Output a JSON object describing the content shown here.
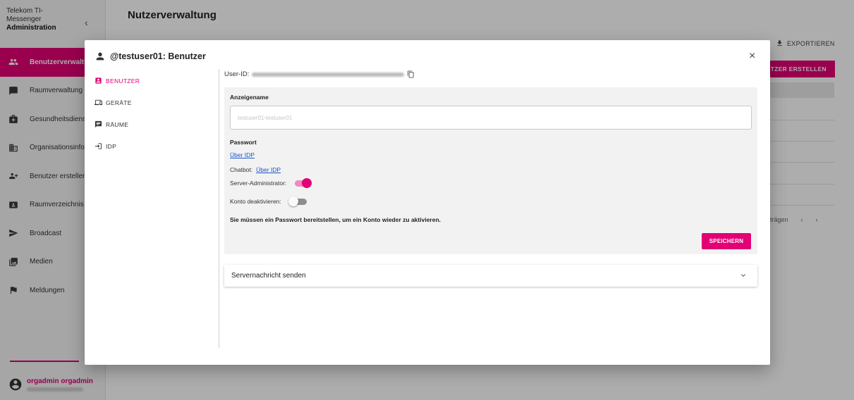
{
  "app": {
    "brand_line1": "Telekom TI-",
    "brand_line2": "Messenger",
    "brand_line3": "Administration",
    "collapse_icon": "‹"
  },
  "sidebar": {
    "items": [
      {
        "label": "Benutzerverwaltung",
        "icon": "people-icon"
      },
      {
        "label": "Raumverwaltung",
        "icon": "chat-icon"
      },
      {
        "label": "Gesundheitsdienste",
        "icon": "medical-bag-icon"
      },
      {
        "label": "Organisationsinfo",
        "icon": "building-icon"
      },
      {
        "label": "Benutzer erstellen",
        "icon": "add-users-icon"
      },
      {
        "label": "Raumverzeichnis",
        "icon": "directory-icon"
      },
      {
        "label": "Broadcast",
        "icon": "send-icon"
      },
      {
        "label": "Medien",
        "icon": "photo-library-icon"
      },
      {
        "label": "Meldungen",
        "icon": "flag-icon"
      }
    ],
    "user_name": "orgadmin orgadmin"
  },
  "main": {
    "title": "Nutzerverwaltung",
    "export_label": "EXPORTIEREN",
    "create_label": "NUTZER ERSTELLEN",
    "pager_text": "trägen"
  },
  "dialog": {
    "title": "@testuser01: Benutzer",
    "close_label": "×",
    "tabs": [
      {
        "label": "BENUTZER",
        "icon": "account-box-icon"
      },
      {
        "label": "GERÄTE",
        "icon": "devices-icon"
      },
      {
        "label": "RÄUME",
        "icon": "chat-icon"
      },
      {
        "label": "IDP",
        "icon": "login-icon"
      }
    ],
    "userid_label": "User-ID:",
    "display_name_label": "Anzeigename",
    "display_name_value": "testuser01-testuser01",
    "password_label": "Passwort",
    "password_link": "Über IDP",
    "chatbot_label": "Chatbot:",
    "chatbot_link": "Über IDP",
    "server_admin_label": "Server-Administrator:",
    "server_admin_on": true,
    "deactivate_label": "Konto deaktivieren:",
    "deactivate_on": false,
    "reactivate_hint": "Sie müssen ein Passwort bereitstellen, um ein Konto wieder zu aktivieren.",
    "save_label": "SPEICHERN",
    "server_message_label": "Servernachricht senden"
  },
  "colors": {
    "accent": "#e20074",
    "link": "#1a55c9"
  }
}
